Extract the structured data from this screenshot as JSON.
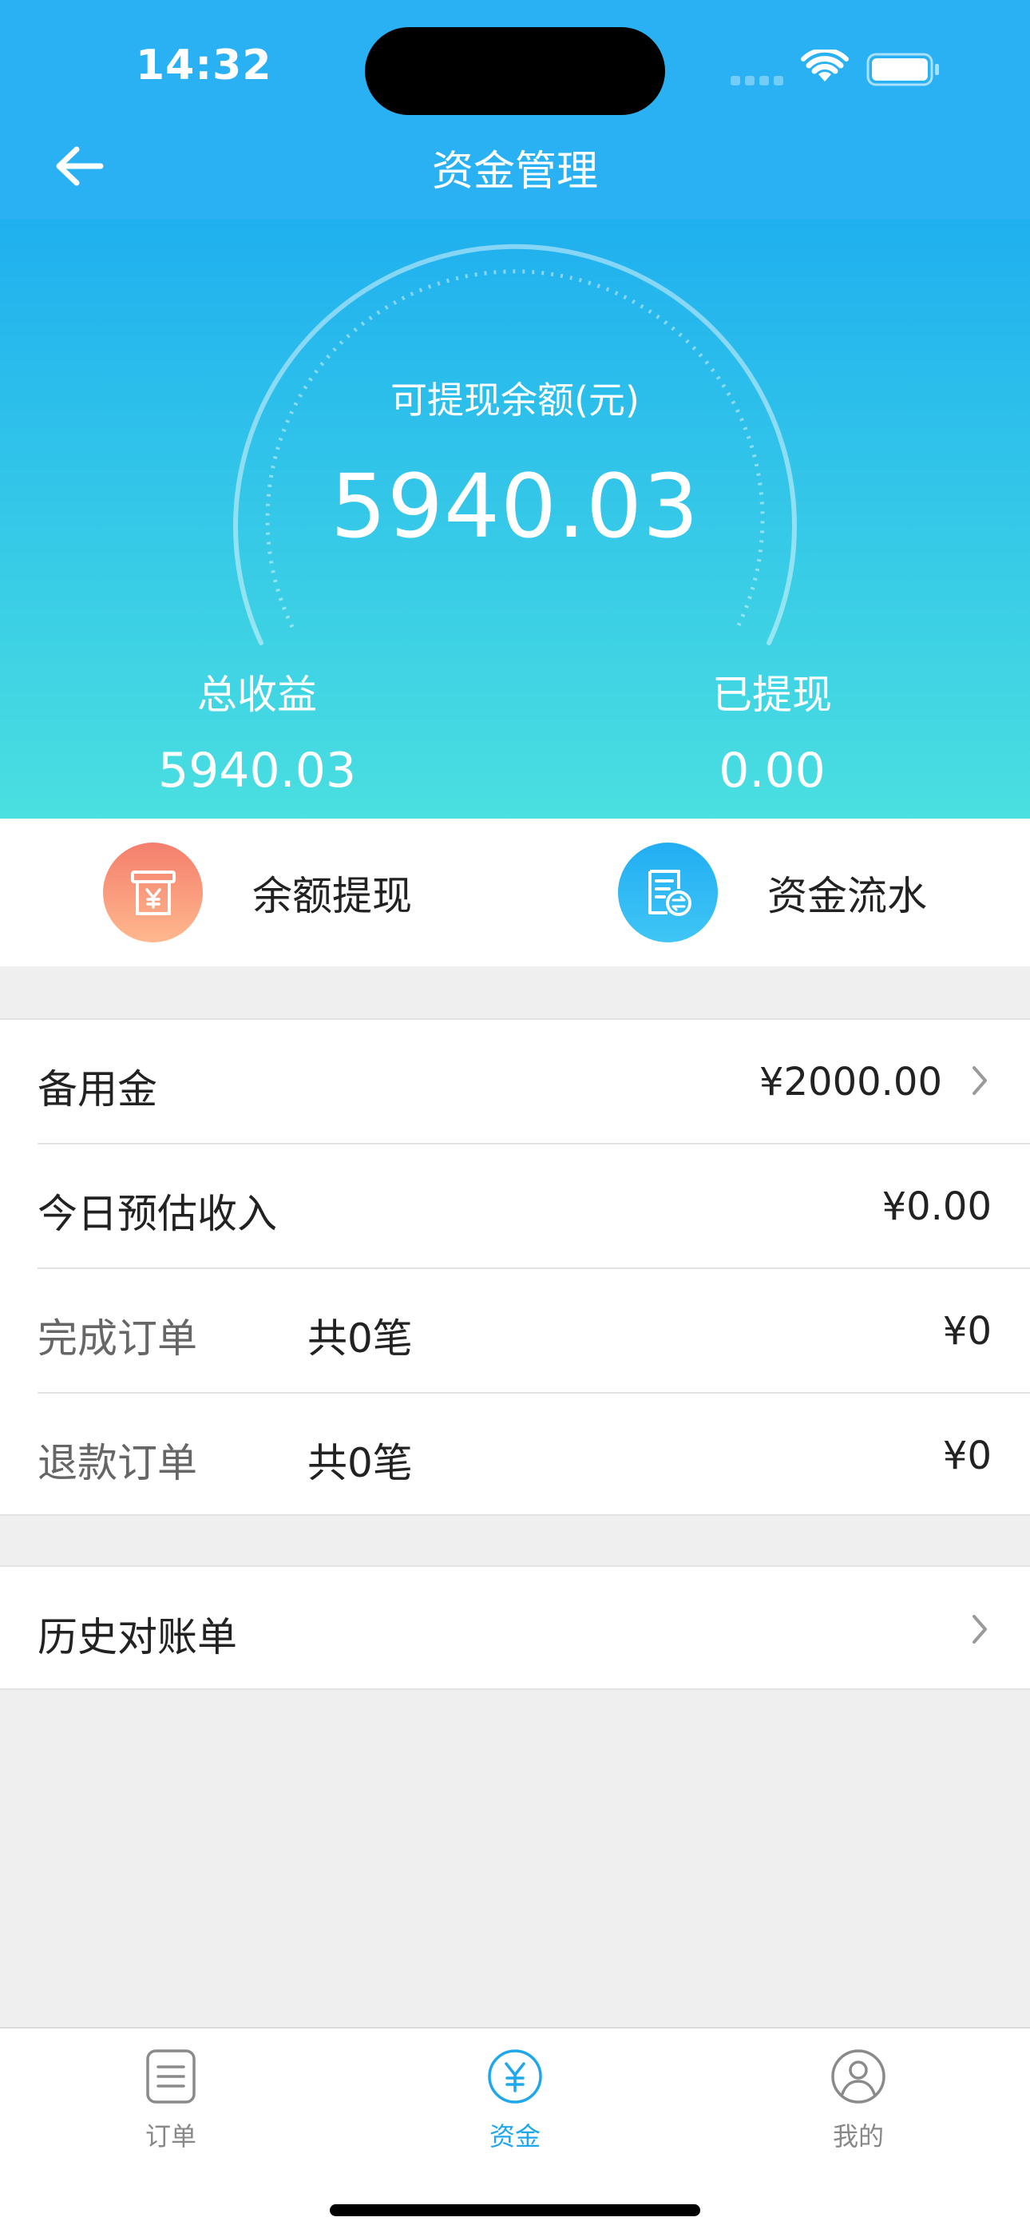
{
  "status_bar": {
    "time": "14:32"
  },
  "header": {
    "title": "资金管理"
  },
  "balance": {
    "label": "可提现余额(元)",
    "amount": "5940.03"
  },
  "stats": {
    "total": {
      "label": "总收益",
      "value": "5940.03"
    },
    "withdrawn": {
      "label": "已提现",
      "value": "0.00"
    }
  },
  "actions": {
    "withdraw_label": "余额提现",
    "flow_label": "资金流水",
    "withdraw_icon": "yuan-receipt-icon",
    "flow_icon": "document-exchange-icon"
  },
  "list": {
    "reserve": {
      "title": "备用金",
      "amount": "¥2000.00"
    },
    "today": {
      "title": "今日预估收入",
      "amount": "¥0.00"
    },
    "completed": {
      "title": "完成订单",
      "count": "共0笔",
      "amount": "¥0"
    },
    "refund": {
      "title": "退款订单",
      "count": "共0笔",
      "amount": "¥0"
    }
  },
  "history": {
    "title": "历史对账单"
  },
  "tabbar": {
    "orders": "订单",
    "funds": "资金",
    "mine": "我的",
    "active": "funds"
  },
  "colors": {
    "brand": "#2ab1f4",
    "active_tab": "#1ea7ec",
    "withdraw_icon_bg": "#f47e6c"
  }
}
